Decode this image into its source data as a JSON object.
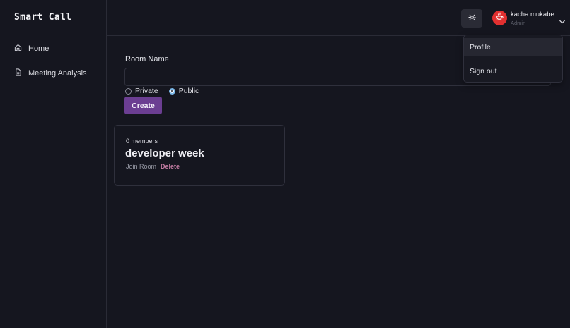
{
  "app": {
    "brand": "Smart Call"
  },
  "sidebar": {
    "items": [
      {
        "label": "Home",
        "icon": "home-icon"
      },
      {
        "label": "Meeting Analysis",
        "icon": "document-icon"
      }
    ]
  },
  "header": {
    "theme_icon": "sun-icon",
    "user": {
      "name": "kacha mukabe",
      "role": "Admin",
      "avatar_icon": "java-logo-icon"
    }
  },
  "form": {
    "room_label": "Room Name",
    "room_value": "",
    "visibility": {
      "options": [
        {
          "label": "Private",
          "selected": false
        },
        {
          "label": "Public",
          "selected": true
        }
      ]
    },
    "create_label": "Create"
  },
  "rooms": [
    {
      "members": "0 members",
      "title": "developer week",
      "join_label": "Join Room",
      "delete_label": "Delete"
    }
  ],
  "user_menu": {
    "items": [
      {
        "label": "Profile",
        "highlighted": true
      },
      {
        "label": "Sign out",
        "highlighted": false
      }
    ]
  },
  "colors": {
    "background": "#15161f",
    "accent": "#6b3e92",
    "delete": "#c07aa0",
    "avatar": "#e23030",
    "radio_selected": "#7bb8e8"
  }
}
